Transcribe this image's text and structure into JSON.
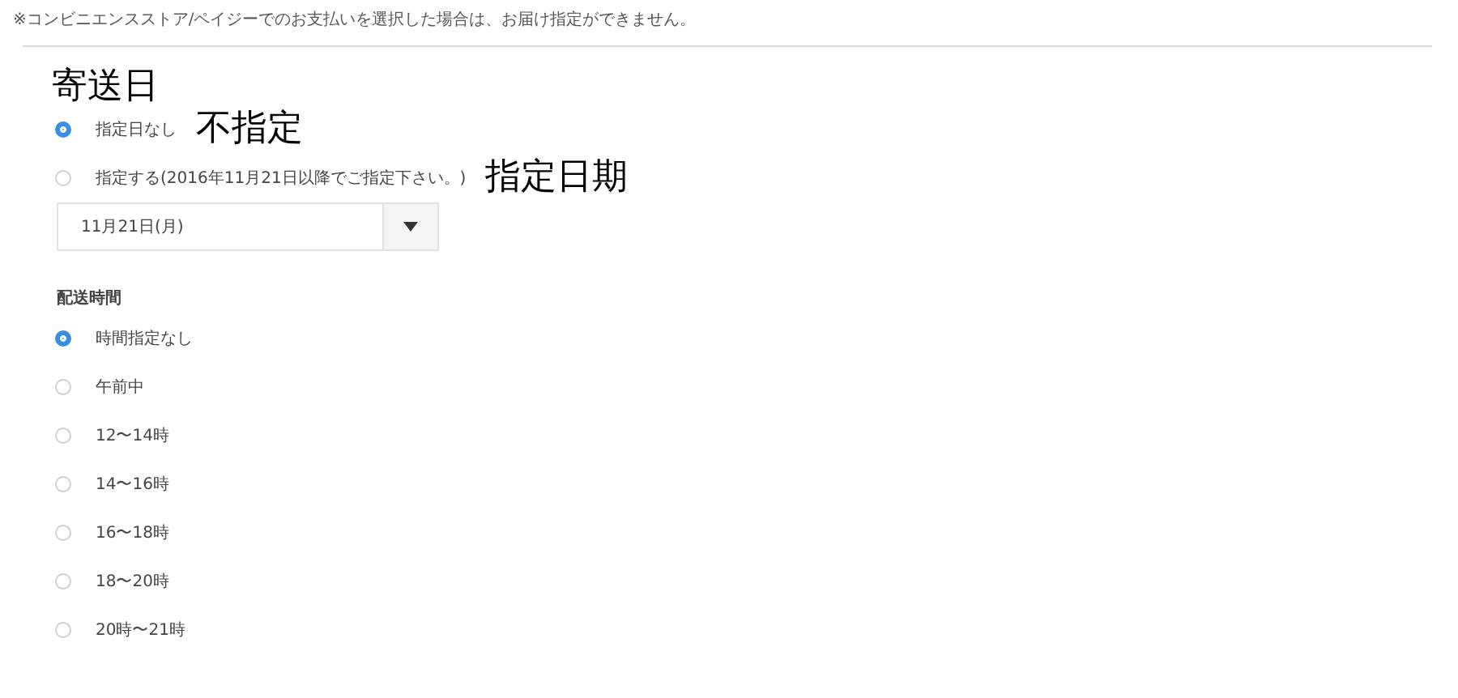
{
  "notice": "※コンビニエンスストア/ペイジーでのお支払いを選択した場合は、お届け指定ができません。",
  "delivery_date": {
    "annotation": "寄送日",
    "options": [
      {
        "label": "指定日なし",
        "selected": true,
        "annotation": "不指定"
      },
      {
        "label": "指定する(2016年11月21日以降でご指定下さい。)",
        "selected": false,
        "annotation": "指定日期"
      }
    ],
    "select": {
      "value": "11月21日(月)"
    }
  },
  "delivery_time": {
    "title": "配送時間",
    "options": [
      {
        "label": "時間指定なし",
        "selected": true
      },
      {
        "label": "午前中",
        "selected": false
      },
      {
        "label": "12〜14時",
        "selected": false
      },
      {
        "label": "14〜16時",
        "selected": false
      },
      {
        "label": "16〜18時",
        "selected": false
      },
      {
        "label": "18〜20時",
        "selected": false
      },
      {
        "label": "20時〜21時",
        "selected": false
      }
    ]
  }
}
